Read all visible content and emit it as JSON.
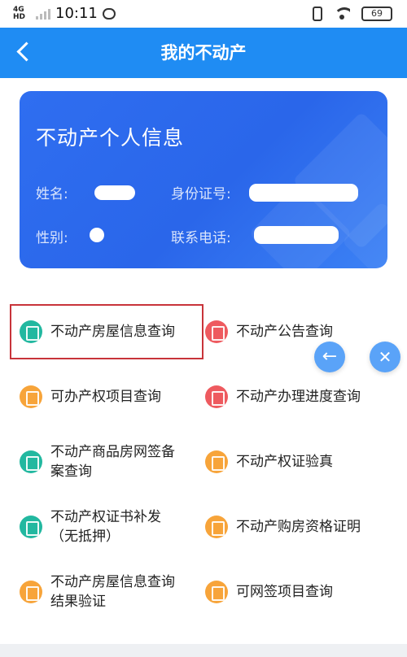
{
  "status_bar": {
    "network": "4G HD",
    "time": "10:11",
    "battery": "69",
    "icons": [
      "signal-icon",
      "chat-icon",
      "vibrate-icon",
      "wifi-icon",
      "battery-icon"
    ]
  },
  "header": {
    "title": "我的不动产"
  },
  "info_card": {
    "title": "不动产个人信息",
    "name_label": "姓名:",
    "gender_label": "性别:",
    "id_label": "身份证号:",
    "phone_label": "联系电话:"
  },
  "services": [
    {
      "label": "不动产房屋信息查询",
      "icon": "house-info-icon",
      "color": "#22b8a0"
    },
    {
      "label": "不动产公告查询",
      "icon": "announcement-icon",
      "color": "#ee5a5f"
    },
    {
      "label": "可办产权项目查询",
      "icon": "project-icon",
      "color": "#f7a43a"
    },
    {
      "label": "不动产办理进度查询",
      "icon": "progress-icon",
      "color": "#ee5a5f"
    },
    {
      "label_line1": "不动产商品房网签备",
      "label_line2": "案查询",
      "icon": "contract-icon",
      "color": "#22b8a0"
    },
    {
      "label": "不动产权证验真",
      "icon": "certificate-verify-icon",
      "color": "#f7a43a"
    },
    {
      "label_line1": "不动产权证书补发",
      "label_line2": "（无抵押）",
      "icon": "certificate-reissue-icon",
      "color": "#22b8a0"
    },
    {
      "label": "不动产购房资格证明",
      "icon": "qualification-icon",
      "color": "#f7a43a"
    },
    {
      "label_line1": "不动产房屋信息查询",
      "label_line2": "结果验证",
      "icon": "result-verify-icon",
      "color": "#f7a43a"
    },
    {
      "label": "可网签项目查询",
      "icon": "online-sign-icon",
      "color": "#f7a43a"
    }
  ],
  "colors": {
    "nav": "#1f8cf3",
    "card": "#2f6ef0",
    "highlight": "#c8343a",
    "float_button": "#5aa3f8"
  }
}
